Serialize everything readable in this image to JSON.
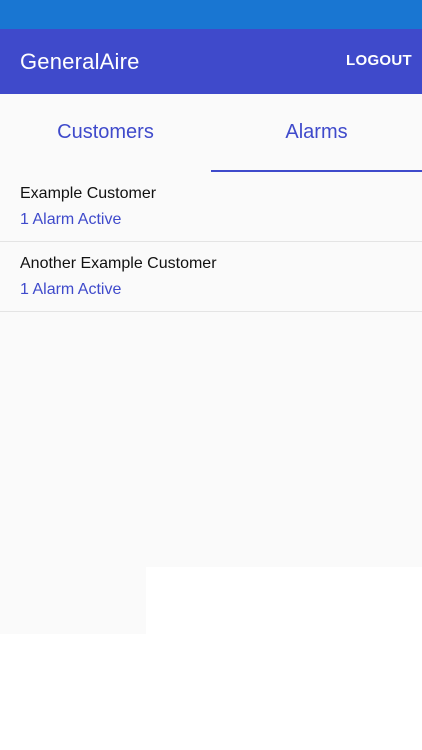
{
  "header": {
    "title": "GeneralAire",
    "logout_label": "LOGOUT"
  },
  "tabs": [
    {
      "label": "Customers",
      "selected": false
    },
    {
      "label": "Alarms",
      "selected": true
    }
  ],
  "alarms": [
    {
      "customer": "Example Customer",
      "status": "1 Alarm Active"
    },
    {
      "customer": "Another Example Customer",
      "status": "1 Alarm Active"
    }
  ],
  "colors": {
    "status_bar": "#1976d2",
    "app_bar": "#3f4acb",
    "accent": "#3f4acb",
    "background": "#fafafa"
  }
}
